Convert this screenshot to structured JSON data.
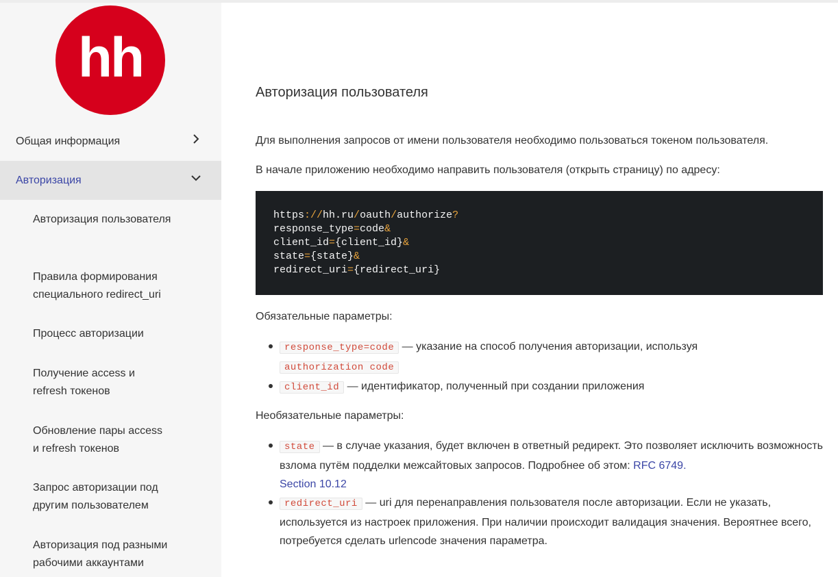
{
  "logo": {
    "text": "hh",
    "color": "#d6001c"
  },
  "nav": [
    {
      "label": "Общая информация",
      "icon": "chevron-right-icon"
    },
    {
      "label": "Авторизация",
      "icon": "chevron-down-icon",
      "active": true
    }
  ],
  "sub_nav": [
    "Авторизация пользователя",
    "Правила формирования специального redirect_uri",
    "Процесс авторизации",
    "Получение access и refresh токенов",
    "Обновление пары access и refresh токенов",
    "Запрос авторизации под другим пользователем",
    "Авторизация под разными рабочими аккаунтами"
  ],
  "content": {
    "title": "Авторизация пользователя",
    "p1": "Для выполнения запросов от имени пользователя необходимо пользоваться токеном пользователя.",
    "p2": "В начале приложению необходимо направить пользователя (открыть страницу) по адресу:",
    "code_lines": [
      "https://hh.ru/oauth/authorize?",
      "response_type=code&",
      "client_id={client_id}&",
      "state={state}&",
      "redirect_uri={redirect_uri}"
    ],
    "required_title": "Обязательные параметры:",
    "required": [
      {
        "code": "response_type=code",
        "text": " — указание на способ получения авторизации, используя ",
        "code2": "authorization code"
      },
      {
        "code": "client_id",
        "text": " — идентификатор, полученный при создании приложения"
      }
    ],
    "optional_title": "Необязательные параметры:",
    "optional": [
      {
        "code": "state",
        "text": " — в случае указания, будет включен в ответный редирект. Это позволяет исключить возможность взлома путём подделки межсайтовых запросов. Подробнее об этом: ",
        "link1": "RFC 6749.",
        "link2": "Section 10.12"
      },
      {
        "code": "redirect_uri",
        "text": " — uri для перенаправления пользователя после авторизации. Если не указать, используется из настроек приложения. При наличии происходит валидация значения. Вероятнее всего, потребуется сделать urlencode значения параметра."
      }
    ]
  },
  "colors": {
    "accent": "#3b46a6",
    "code_bg": "#1c1f22",
    "inline_code": "#d14a3a",
    "sidebar_bg": "#f6f6f6",
    "active_bg": "#e4e4e4"
  }
}
